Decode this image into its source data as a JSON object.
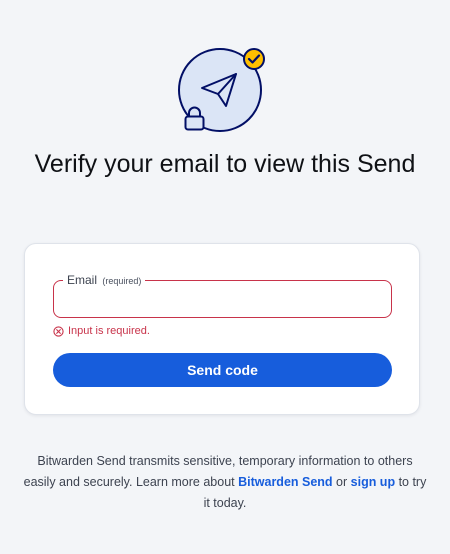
{
  "page": {
    "title": "Verify your email to view this Send"
  },
  "form": {
    "email_label": "Email",
    "email_required_hint": "(required)",
    "email_value": "",
    "error_message": "Input is required.",
    "submit_label": "Send code"
  },
  "footer": {
    "text_before": "Bitwarden Send transmits sensitive, temporary information to others easily and securely. Learn more about ",
    "link_learn_more": "Bitwarden Send",
    "text_middle": " or ",
    "link_signup": "sign up",
    "text_after": " to try it today."
  },
  "icons": {
    "hero": "paper-plane-icon",
    "hero_badge": "check-badge-icon",
    "hero_lock": "lock-icon",
    "error": "error-circle-icon"
  },
  "colors": {
    "accent": "#175ddc",
    "error": "#c8334a",
    "hero_fill": "#dbe5f6",
    "hero_stroke": "#020f66",
    "badge_fill": "#ffbf00",
    "background": "#f3f5f8"
  }
}
